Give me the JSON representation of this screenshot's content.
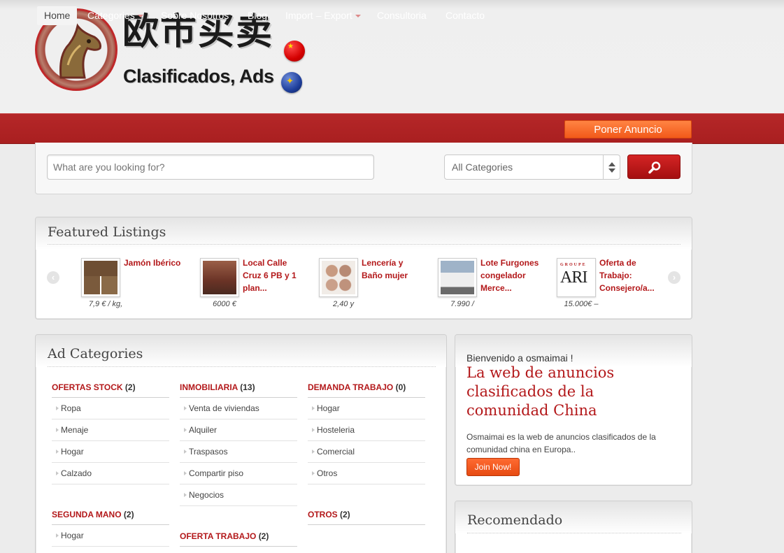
{
  "logo": {
    "chinese": "欧市买卖",
    "spanish": "Clasificados, Ads",
    "star": "★",
    "eu_stars": "✦"
  },
  "nav": {
    "items": [
      {
        "label": "Home",
        "active": true
      },
      {
        "label": "Categories",
        "dropdown": true
      },
      {
        "label": "Sobre Nosotros"
      },
      {
        "label": "Blog"
      },
      {
        "label": "Import – Export",
        "dropdown": true
      },
      {
        "label": "Consultoria"
      },
      {
        "label": "Contacto"
      }
    ],
    "post_ad": "Poner Anuncio"
  },
  "search": {
    "placeholder": "What are you looking for?",
    "category": "All Categories"
  },
  "featured": {
    "title": "Featured Listings",
    "prev_icon": "‹",
    "next_icon": "›",
    "items": [
      {
        "title": "Jamón Ibérico",
        "price": "7,9 € / kg,"
      },
      {
        "title": "Local Calle Cruz 6 PB y 1 plan...",
        "price": "6000 €"
      },
      {
        "title": "Lencería y Baño mujer",
        "price": "2,40 y"
      },
      {
        "title": "Lote Furgones congelador Merce...",
        "price": "7.990 /"
      },
      {
        "title": "Oferta de Trabajo: Consejero/a...",
        "price": "15.000€ –"
      }
    ],
    "ari_logo_top": "GROUPE",
    "ari_logo_main": "ARI"
  },
  "categories": {
    "title": "Ad Categories",
    "groups": [
      {
        "name": "OFERTAS STOCK",
        "count": "(2)",
        "items": [
          "Ropa",
          "Menaje",
          "Hogar",
          "Calzado"
        ]
      },
      {
        "name": "INMOBILIARIA",
        "count": "(13)",
        "items": [
          "Venta de viviendas",
          "Alquiler",
          "Traspasos",
          "Compartir piso",
          "Negocios"
        ]
      },
      {
        "name": "DEMANDA TRABAJO",
        "count": "(0)",
        "items": [
          "Hogar",
          "Hosteleria",
          "Comercial",
          "Otros"
        ]
      },
      {
        "name": "SEGUNDA MANO",
        "count": "(2)",
        "items": [
          "Hogar"
        ]
      },
      {
        "name": "OFERTA TRABAJO",
        "count": "(2)",
        "items": []
      },
      {
        "name": "OTROS",
        "count": "(2)",
        "items": []
      }
    ]
  },
  "welcome": {
    "greeting": "Bienvenido a osmaimai !",
    "headline": "La web de anuncios clasificados de la comunidad China",
    "description": "Osmaimai es la web de anuncios clasificados de la comunidad china en Europa..",
    "join": "Join Now!"
  },
  "recommended": {
    "title": "Recomendado"
  },
  "colors": {
    "brand_red": "#b3181a",
    "nav_red": "#b52728",
    "accent_orange": "#f2591a"
  }
}
